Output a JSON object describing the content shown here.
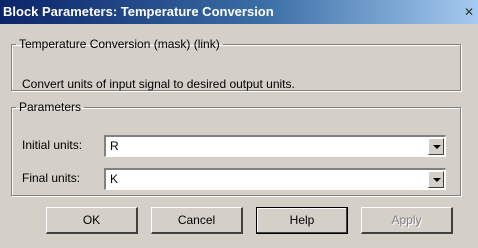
{
  "window": {
    "title": "Block Parameters: Temperature Conversion",
    "close_glyph": "✕"
  },
  "description": {
    "group_label": "Temperature Conversion (mask) (link)",
    "text": "Convert units of input signal to desired output units."
  },
  "parameters": {
    "group_label": "Parameters",
    "initial_units": {
      "label": "Initial units:",
      "value": "R"
    },
    "final_units": {
      "label": "Final units:",
      "value": "K"
    }
  },
  "buttons": {
    "ok": "OK",
    "cancel": "Cancel",
    "help": "Help",
    "apply": "Apply"
  }
}
